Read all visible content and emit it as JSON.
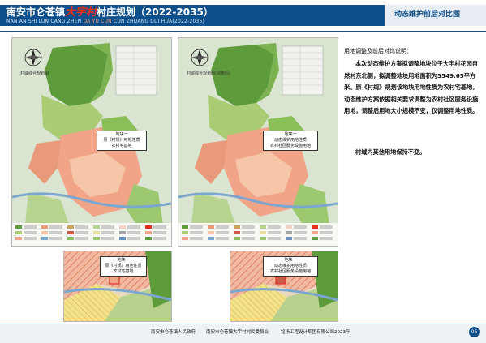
{
  "header": {
    "title_prefix": "南安市仑苍镇",
    "title_highlight": "大宇村",
    "title_suffix": "村庄规划（2022-2035）",
    "subtitle_prefix": "NAN AN SHI LUN CANG ZHEN",
    "subtitle_highlight": "DA YU CUN",
    "subtitle_suffix": "CUN ZHUANG GUI HUA(2022-2035)",
    "section": "动态维护前后对比图"
  },
  "maps": {
    "left_caption": "村域综合规划图",
    "right_caption": "村域综合规划图(调整后)",
    "left_callout": [
      "地块一",
      "原《村规》用地性质",
      "农村宅基地"
    ],
    "right_callout": [
      "地块一",
      "动态维护用地性质",
      "农村社区服务设施用地"
    ],
    "left_detail_callout": [
      "地块一",
      "原《村规》用地性质",
      "农村宅基地"
    ],
    "right_detail_callout": [
      "地块一",
      "动态维护用地性质",
      "农村社区服务设施用地"
    ]
  },
  "notes": {
    "title": "用地调整及前后对比说明：",
    "paragraph1": "本次动态维护方案拟调整地块位于大宇村花园自然村东北侧，拟调整地块用地面积为3549.65平方米。原《村规》规划该地块用地性质为农村宅基地，动态维护方案依据相关要求调整为农村社区服务设施用地，调整后用地大小规模不变，仅调整用地性质。",
    "paragraph2": "村域内其他用地保持不变。"
  },
  "footer": {
    "org1": "南安市仑苍镇人民政府",
    "org2": "南安市仑苍镇大宇村村民委员会",
    "org3": "铭扬工程设计集团有限公司",
    "year": "2023年",
    "page": "06"
  },
  "colors": {
    "header_blue": "#0d4f8b",
    "forest": "#5e9b3a",
    "residential": "#f2a488",
    "highlight": "#e0341e"
  }
}
